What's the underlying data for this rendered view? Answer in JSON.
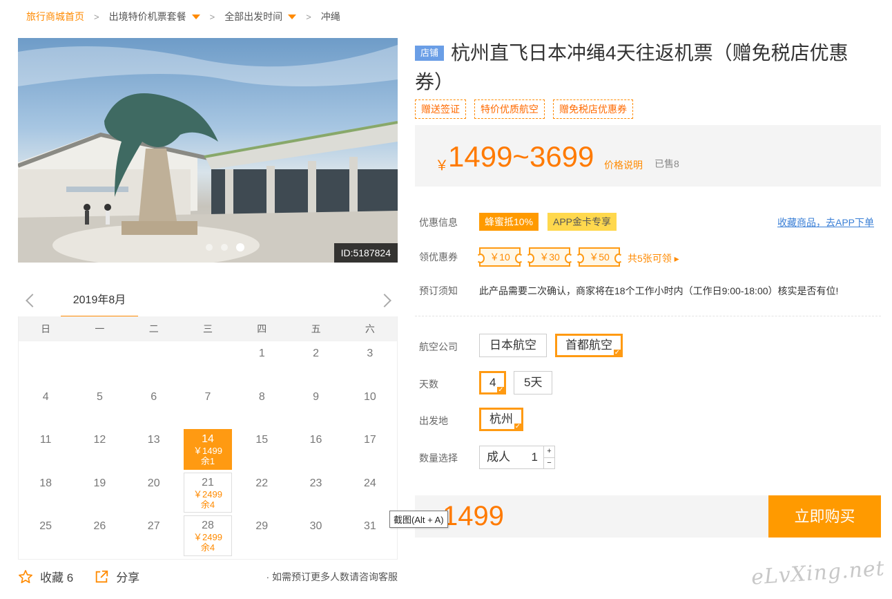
{
  "breadcrumb": {
    "home": "旅行商城首页",
    "items": [
      "出境特价机票套餐",
      "全部出发时间"
    ],
    "current": "冲绳",
    "separator": ">"
  },
  "hero": {
    "id_label": "ID:5187824",
    "slide_count": 3,
    "active_slide": 3
  },
  "calendar": {
    "month": "2019年8月",
    "weekdays": [
      "日",
      "一",
      "二",
      "三",
      "四",
      "五",
      "六"
    ],
    "days": [
      {
        "n": ""
      },
      {
        "n": ""
      },
      {
        "n": ""
      },
      {
        "n": ""
      },
      {
        "n": "1"
      },
      {
        "n": "2"
      },
      {
        "n": "3"
      },
      {
        "n": "4"
      },
      {
        "n": "5"
      },
      {
        "n": "6"
      },
      {
        "n": "7"
      },
      {
        "n": "8"
      },
      {
        "n": "9"
      },
      {
        "n": "10"
      },
      {
        "n": "11"
      },
      {
        "n": "12"
      },
      {
        "n": "13"
      },
      {
        "n": "14",
        "price": "￥1499",
        "left": "余1",
        "selected": true
      },
      {
        "n": "15"
      },
      {
        "n": "16"
      },
      {
        "n": "17"
      },
      {
        "n": "18"
      },
      {
        "n": "19"
      },
      {
        "n": "20"
      },
      {
        "n": "21",
        "price": "￥2499",
        "left": "余4"
      },
      {
        "n": "22"
      },
      {
        "n": "23"
      },
      {
        "n": "24"
      },
      {
        "n": "25"
      },
      {
        "n": "26"
      },
      {
        "n": "27"
      },
      {
        "n": "28",
        "price": "￥2499",
        "left": "余4"
      },
      {
        "n": "29"
      },
      {
        "n": "30"
      },
      {
        "n": "31"
      }
    ]
  },
  "actions": {
    "favorite": "收藏 6",
    "share": "分享",
    "note": "· 如需预订更多人数请咨询客服"
  },
  "product": {
    "shop_badge": "店铺",
    "title": "杭州直飞日本冲绳4天往返机票（赠免税店优惠券）",
    "tags": [
      "赠送签证",
      "特价优质航空",
      "赠免税店优惠券"
    ],
    "price_symbol": "￥",
    "price_range": "1499~3699",
    "price_explain": "价格说明",
    "sold": "已售8"
  },
  "promotions": {
    "label": "优惠信息",
    "items": [
      "蜂蜜抵10%",
      "APP金卡专享"
    ],
    "fav_link": "收藏商品，去APP下单"
  },
  "coupons": {
    "label": "领优惠券",
    "items": [
      "￥10",
      "￥30",
      "￥50"
    ],
    "more": "共5张可领 ▸"
  },
  "notice": {
    "label": "预订须知",
    "text": "此产品需要二次确认，商家将在18个工作小时内（工作日9:00-18:00）核实是否有位!"
  },
  "options": {
    "airline_label": "航空公司",
    "airlines": [
      "日本航空",
      "首都航空"
    ],
    "days_label": "天数",
    "days": [
      "4",
      "5天"
    ],
    "departure_label": "出发地",
    "departure": "杭州",
    "qty_label": "数量选择",
    "qty_type": "成人",
    "qty_value": "1",
    "plus": "+",
    "minus": "−"
  },
  "purchase": {
    "price": "1499",
    "button": "立即购买",
    "tooltip": "截图(Alt + A)"
  },
  "watermark": "eLvXing.net",
  "colors": {
    "accent": "#ff9a00",
    "price": "#ff7a00",
    "link": "#3a7fd6",
    "badge": "#6a9ee6"
  }
}
